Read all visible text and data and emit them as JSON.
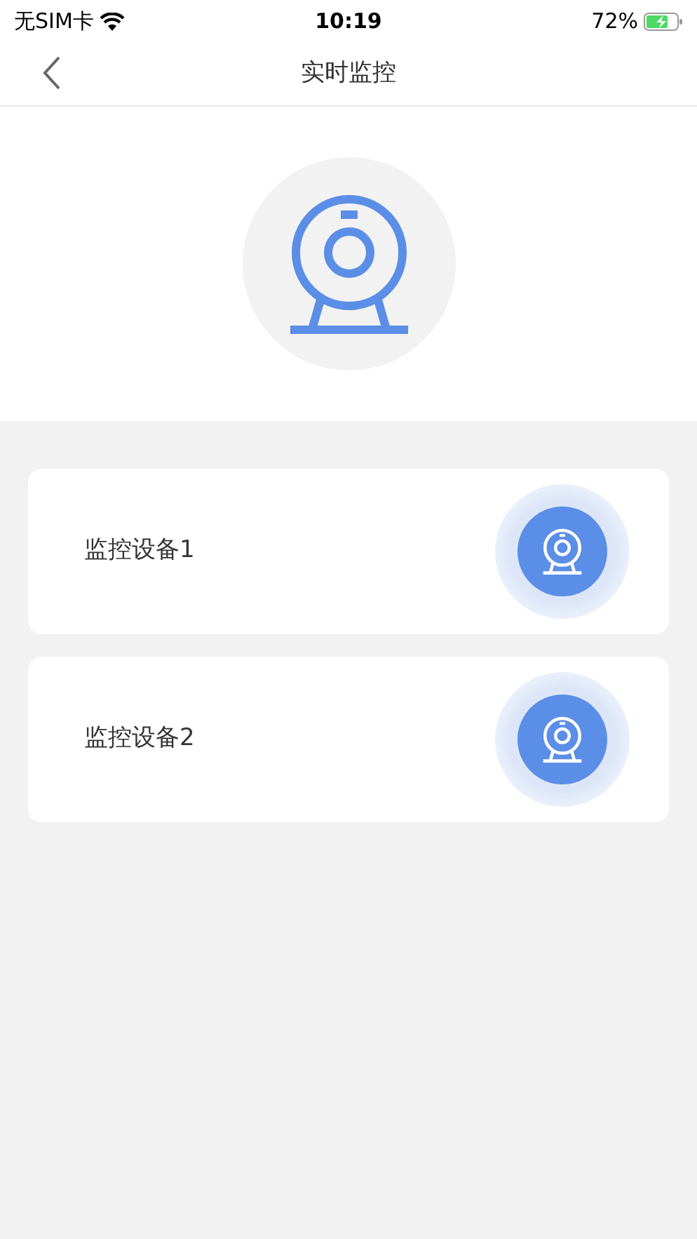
{
  "status_bar": {
    "carrier": "无SIM卡",
    "time": "10:19",
    "battery": "72%"
  },
  "nav_bar": {
    "title": "实时监控"
  },
  "devices": [
    {
      "name": "监控设备1"
    },
    {
      "name": "监控设备2"
    }
  ]
}
